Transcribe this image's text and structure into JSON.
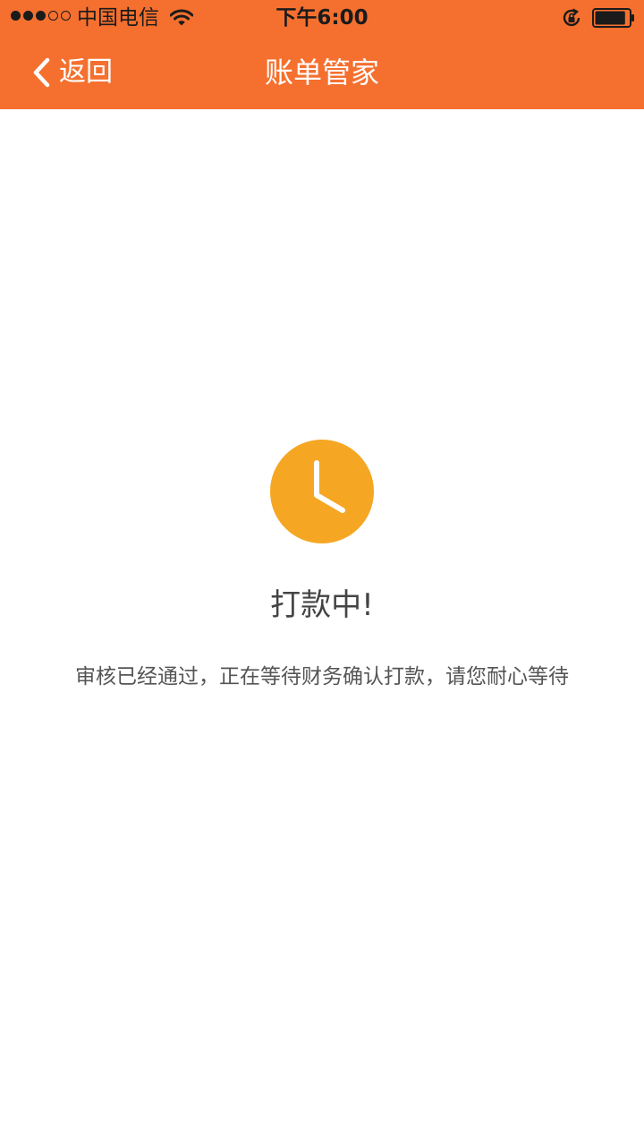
{
  "status_bar": {
    "carrier": "中国电信",
    "time": "下午6:00",
    "signal_strength": 3,
    "signal_total": 5,
    "battery_level": 0.9
  },
  "nav": {
    "back_label": "返回",
    "title": "账单管家"
  },
  "content": {
    "status_icon": "clock-icon",
    "title": "打款中!",
    "message": "审核已经通过，正在等待财务确认打款，请您耐心等待"
  },
  "colors": {
    "accent": "#f5702f",
    "clock": "#f5a623",
    "text": "#444444"
  }
}
